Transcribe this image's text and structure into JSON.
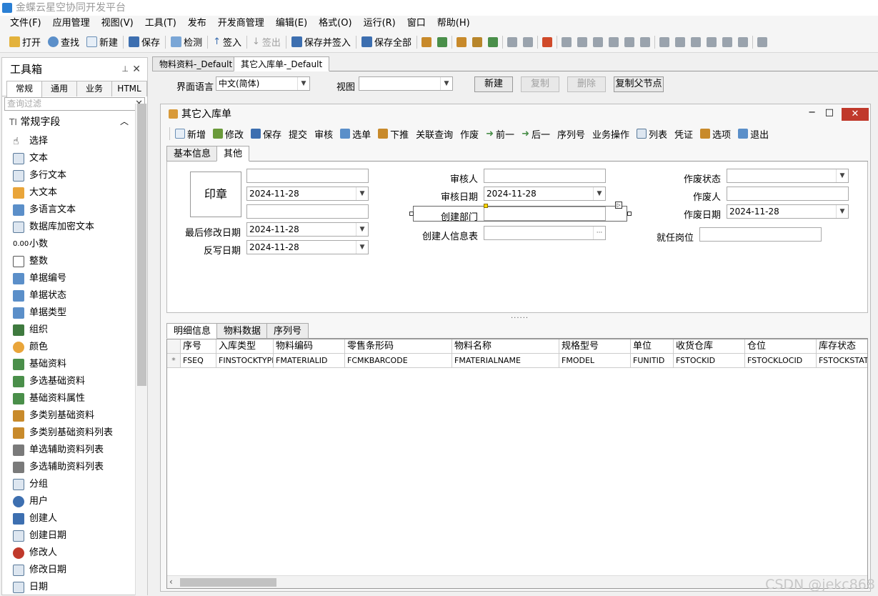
{
  "app": {
    "title": "金蝶云星空协同开发平台"
  },
  "menu": [
    "文件(F)",
    "应用管理",
    "视图(V)",
    "工具(T)",
    "发布",
    "开发商管理",
    "编辑(E)",
    "格式(O)",
    "运行(R)",
    "窗口",
    "帮助(H)"
  ],
  "toolbar": {
    "open": "打开",
    "find": "查找",
    "new": "新建",
    "save": "保存",
    "check": "检测",
    "checkin": "签入",
    "checkout": "签出",
    "save_checkin": "保存并签入",
    "save_all": "保存全部"
  },
  "toolbox": {
    "title": "工具箱",
    "tabs": [
      "常规",
      "通用",
      "业务",
      "HTML"
    ],
    "filter_placeholder": "查询过滤",
    "section": "常规字段",
    "items": [
      "选择",
      "文本",
      "多行文本",
      "大文本",
      "多语言文本",
      "数据库加密文本",
      "小数",
      "整数",
      "单据编号",
      "单据状态",
      "单据类型",
      "组织",
      "颜色",
      "基础资料",
      "多选基础资料",
      "基础资料属性",
      "多类别基础资料",
      "多类别基础资料列表",
      "单选辅助资料列表",
      "多选辅助资料列表",
      "分组",
      "用户",
      "创建人",
      "创建日期",
      "修改人",
      "修改日期",
      "日期"
    ]
  },
  "doc_tabs": [
    "物料资料-_Default",
    "其它入库单-_Default"
  ],
  "options_bar": {
    "lang_label": "界面语言",
    "lang_value": "中文(简体)",
    "view_label": "视图",
    "view_value": "",
    "btn_new": "新建",
    "btn_copy": "复制",
    "btn_delete": "删除",
    "btn_copy_parent": "复制父节点"
  },
  "form": {
    "title": "其它入库单",
    "toolbar": [
      "新增",
      "修改",
      "保存",
      "提交",
      "审核",
      "选单",
      "下推",
      "关联查询",
      "作废",
      "前一",
      "后一",
      "序列号",
      "业务操作",
      "列表",
      "凭证",
      "选项",
      "退出"
    ],
    "tabs": [
      "基本信息",
      "其他"
    ],
    "seal": "印章",
    "fields": {
      "date1": "2024-11-28",
      "last_modified_label": "最后修改日期",
      "last_modified": "2024-11-28",
      "writeback_label": "反写日期",
      "writeback": "2024-11-28",
      "approver_label": "审核人",
      "approver": "",
      "approve_date_label": "审核日期",
      "approve_date": "2024-11-28",
      "creator_dept_label": "创建部门",
      "creator_dept": "",
      "creator_info_label": "创建人信息表",
      "creator_info": "",
      "void_status_label": "作废状态",
      "void_status": "",
      "voider_label": "作废人",
      "voider": "",
      "void_date_label": "作废日期",
      "void_date": "2024-11-28",
      "position_label": "就任岗位",
      "position": ""
    },
    "detail_tabs": [
      "明细信息",
      "物料数据",
      "序列号"
    ],
    "grid": {
      "columns": [
        "序号",
        "入库类型",
        "物料编码",
        "零售条形码",
        "物料名称",
        "规格型号",
        "单位",
        "收货仓库",
        "仓位",
        "库存状态"
      ],
      "row_marker": "*",
      "row": [
        "FSEQ",
        "FINSTOCKTYPE",
        "FMATERIALID",
        "FCMKBARCODE",
        "FMATERIALNAME",
        "FMODEL",
        "FUNITID",
        "FSTOCKID",
        "FSTOCKLOCID",
        "FSTOCKSTATU"
      ]
    }
  },
  "watermark": "CSDN @jekc868",
  "colors": {
    "accent": "#2a7fd4",
    "close": "#c0392b",
    "selection": "#ffd700"
  }
}
